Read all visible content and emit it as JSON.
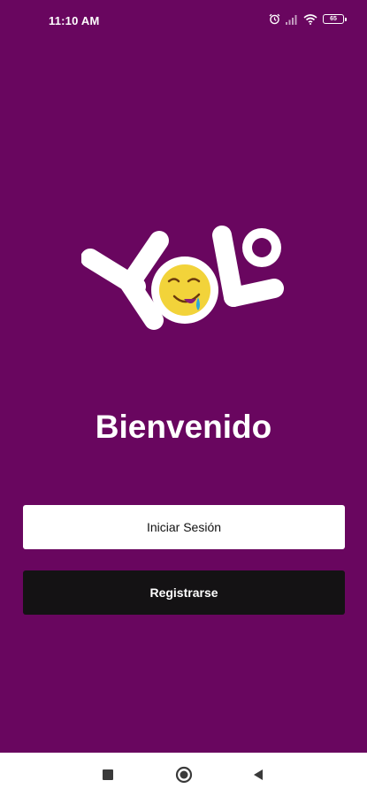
{
  "status_bar": {
    "time": "11:10 AM",
    "battery": "65",
    "icons": [
      "alarm-icon",
      "signal-icon",
      "wifi-icon",
      "battery-icon"
    ]
  },
  "logo": {
    "text": "YOLO",
    "brand_color": "#ffffff",
    "emoji_color": "#f2d33a"
  },
  "welcome_title": "Bienvenido",
  "buttons": {
    "login_label": "Iniciar Sesión",
    "register_label": "Registrarse"
  },
  "nav_bar": {
    "icons": [
      "recents-square-icon",
      "home-circle-icon",
      "back-triangle-icon"
    ]
  },
  "colors": {
    "background": "#69065f",
    "login_bg": "#ffffff",
    "register_bg": "#141214"
  }
}
